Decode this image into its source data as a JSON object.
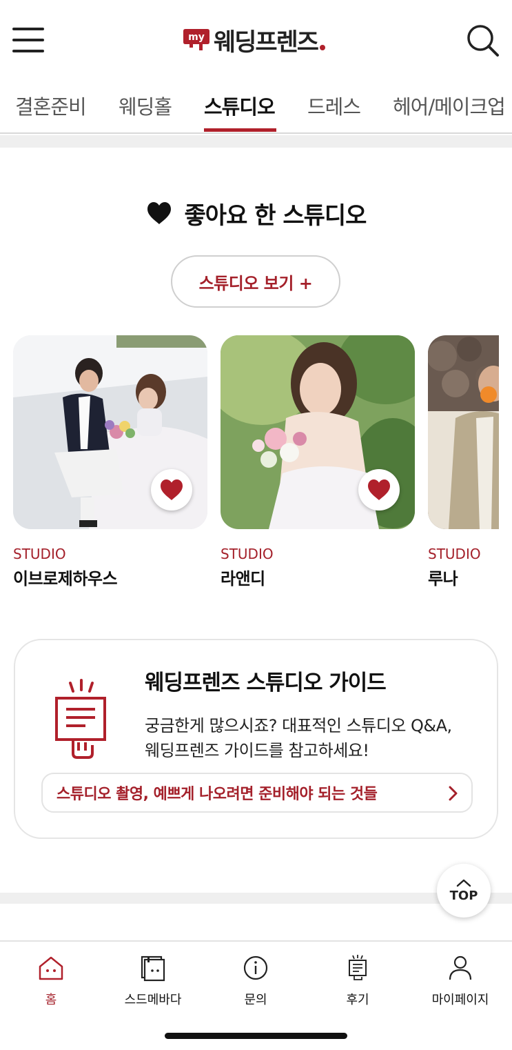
{
  "header": {
    "logo_badge": "my",
    "logo_text": "웨딩프렌즈",
    "menu_icon": "hamburger-menu-icon",
    "search_icon": "search-icon"
  },
  "tabs": [
    {
      "label": "결혼준비",
      "active": false
    },
    {
      "label": "웨딩홀",
      "active": false
    },
    {
      "label": "스튜디오",
      "active": true
    },
    {
      "label": "드레스",
      "active": false
    },
    {
      "label": "헤어/메이크업",
      "active": false
    }
  ],
  "liked": {
    "title": "좋아요 한 스튜디오",
    "view_button": "스튜디오 보기 +"
  },
  "cards": [
    {
      "category": "STUDIO",
      "name": "이브로제하우스",
      "liked": true
    },
    {
      "category": "STUDIO",
      "name": "라앤디",
      "liked": true
    },
    {
      "category": "STUDIO",
      "name": "루나",
      "liked": false
    }
  ],
  "guide": {
    "title": "웨딩프렌즈 스튜디오 가이드",
    "desc_line1": "궁금한게 많으시죠? 대표적인 스튜디오 Q&A,",
    "desc_line2": "웨딩프렌즈 가이드를 참고하세요!",
    "link": "스튜디오 촬영, 예쁘게 나오려면 준비해야 되는 것들"
  },
  "top_button": "TOP",
  "bottom_nav": [
    {
      "label": "홈",
      "icon": "home-icon",
      "active": true
    },
    {
      "label": "스드메바다",
      "icon": "catalog-icon",
      "active": false
    },
    {
      "label": "문의",
      "icon": "info-icon",
      "active": false
    },
    {
      "label": "후기",
      "icon": "review-icon",
      "active": false
    },
    {
      "label": "마이페이지",
      "icon": "person-icon",
      "active": false
    }
  ],
  "colors": {
    "brand": "#b0202b",
    "accent_text": "#a4202a"
  }
}
